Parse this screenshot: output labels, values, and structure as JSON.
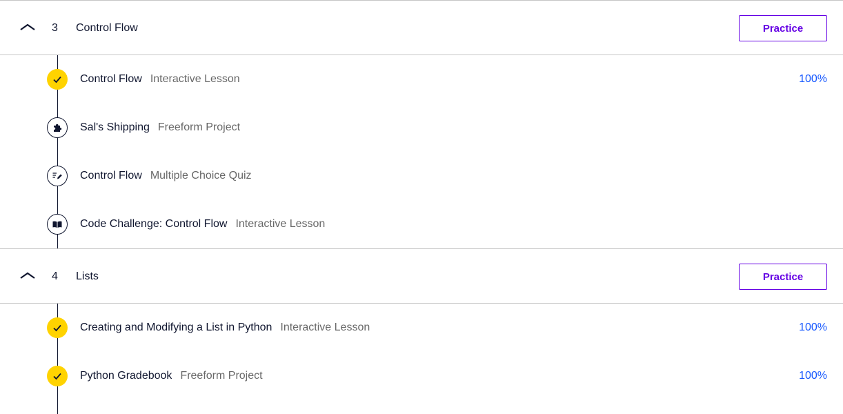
{
  "modules": [
    {
      "number": "3",
      "title": "Control Flow",
      "practice_label": "Practice",
      "items": [
        {
          "title": "Control Flow",
          "type": "Interactive Lesson",
          "status": "complete",
          "icon": "check-icon",
          "progress": "100%"
        },
        {
          "title": "Sal's Shipping",
          "type": "Freeform Project",
          "status": "incomplete",
          "icon": "puzzle-icon",
          "progress": ""
        },
        {
          "title": "Control Flow",
          "type": "Multiple Choice Quiz",
          "status": "incomplete",
          "icon": "quiz-icon",
          "progress": ""
        },
        {
          "title": "Code Challenge: Control Flow",
          "type": "Interactive Lesson",
          "status": "incomplete",
          "icon": "book-icon",
          "progress": ""
        }
      ]
    },
    {
      "number": "4",
      "title": "Lists",
      "practice_label": "Practice",
      "items": [
        {
          "title": "Creating and Modifying a List in Python",
          "type": "Interactive Lesson",
          "status": "complete",
          "icon": "check-icon",
          "progress": "100%"
        },
        {
          "title": "Python Gradebook",
          "type": "Freeform Project",
          "status": "complete",
          "icon": "check-icon",
          "progress": "100%"
        }
      ]
    }
  ],
  "colors": {
    "accent": "#6400e4",
    "complete": "#ffd300",
    "progress_text": "#1557ff",
    "secondary_text": "#686868",
    "divider": "#c6c6c6"
  }
}
